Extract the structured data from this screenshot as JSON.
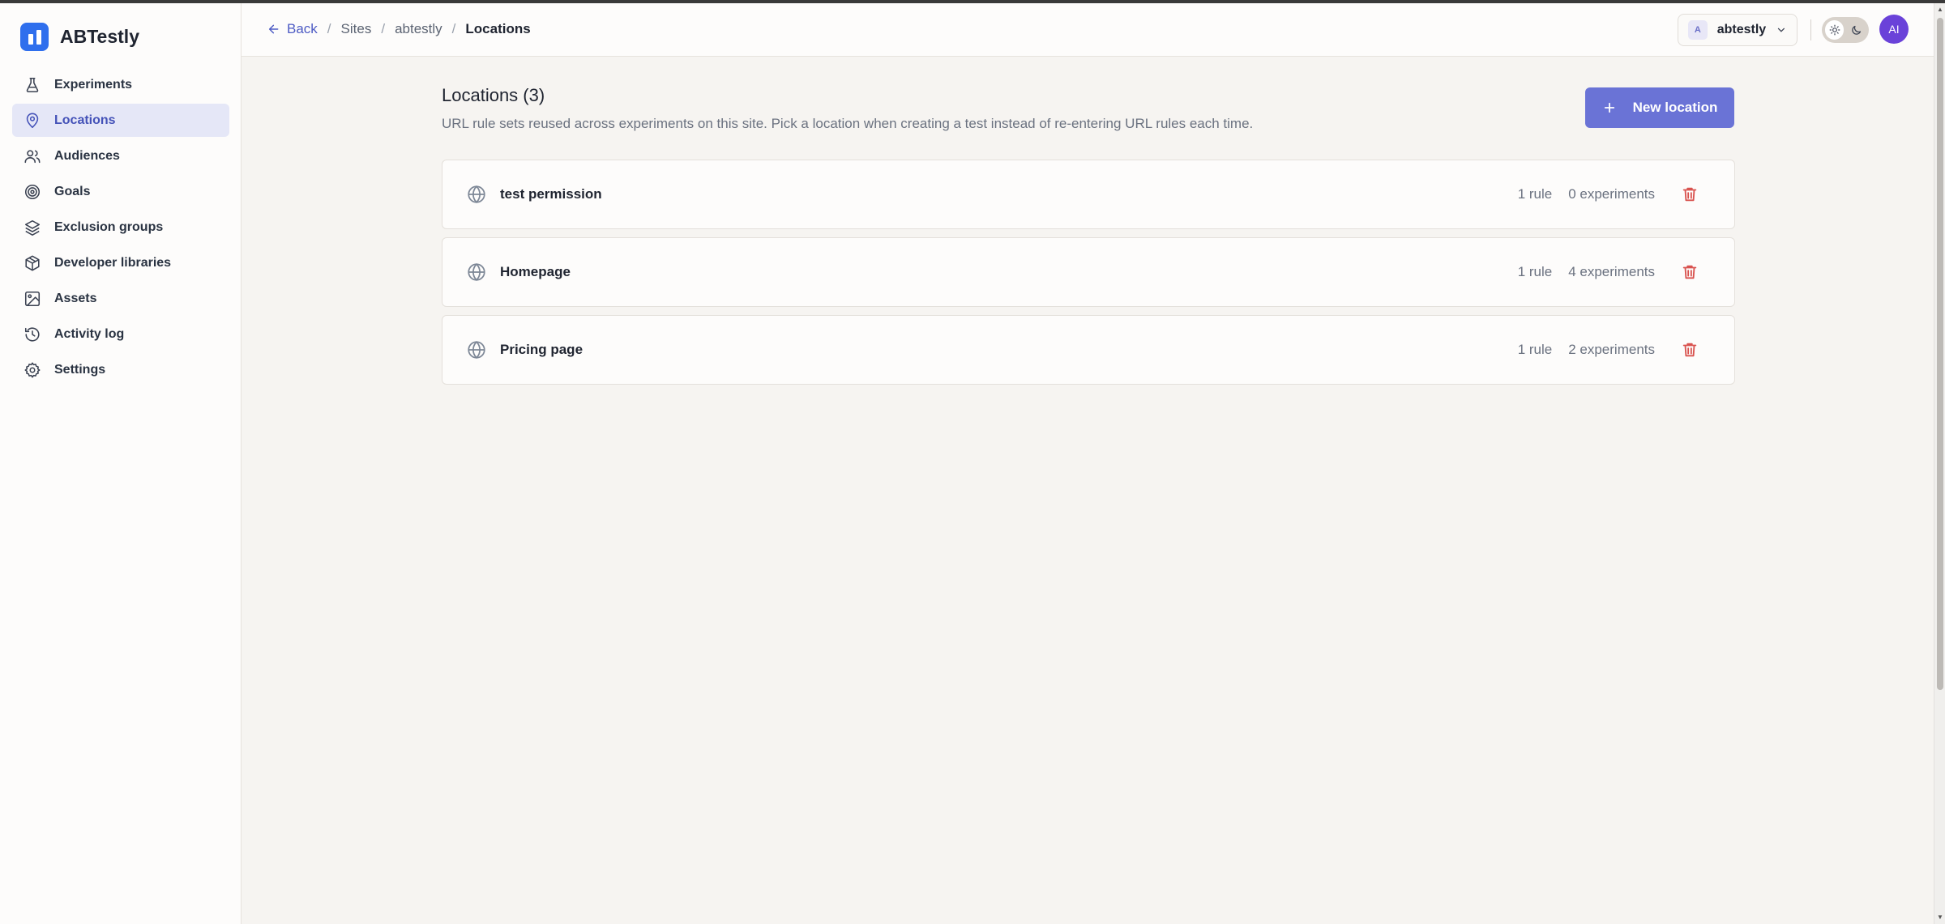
{
  "app": {
    "name": "ABTestly"
  },
  "sidebar": {
    "items": [
      {
        "label": "Experiments",
        "icon": "flask-icon"
      },
      {
        "label": "Locations",
        "icon": "map-pin-icon",
        "active": true
      },
      {
        "label": "Audiences",
        "icon": "users-icon"
      },
      {
        "label": "Goals",
        "icon": "target-icon"
      },
      {
        "label": "Exclusion groups",
        "icon": "layers-icon"
      },
      {
        "label": "Developer libraries",
        "icon": "package-icon"
      },
      {
        "label": "Assets",
        "icon": "image-icon"
      },
      {
        "label": "Activity log",
        "icon": "history-icon"
      },
      {
        "label": "Settings",
        "icon": "gear-icon"
      }
    ]
  },
  "header": {
    "back_label": "Back",
    "breadcrumbs": [
      "Sites",
      "abtestly",
      "Locations"
    ],
    "site": {
      "badge": "A",
      "name": "abtestly"
    },
    "avatar_initials": "AI"
  },
  "main": {
    "title": "Locations (3)",
    "description": "URL rule sets reused across experiments on this site. Pick a location when creating a test instead of re-entering URL rules each time.",
    "new_button_label": "New location",
    "locations": [
      {
        "name": "test permission",
        "rules": "1 rule",
        "experiments": "0 experiments"
      },
      {
        "name": "Homepage",
        "rules": "1 rule",
        "experiments": "4 experiments"
      },
      {
        "name": "Pricing page",
        "rules": "1 rule",
        "experiments": "2 experiments"
      }
    ]
  },
  "colors": {
    "accent": "#6a73d6",
    "brand": "#2f6fed",
    "active_nav_bg": "#e5e7f7",
    "delete": "#d9534f"
  }
}
